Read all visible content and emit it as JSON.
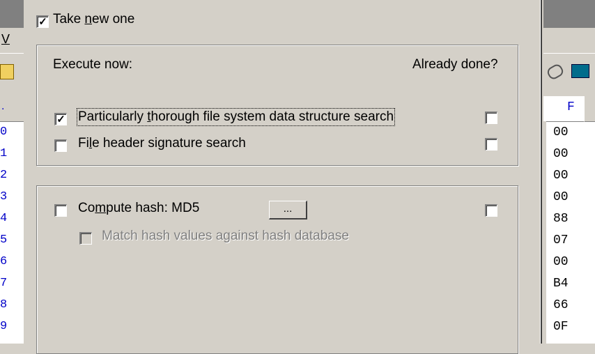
{
  "background": {
    "menu_char": "V",
    "offsets": [
      "0",
      "1",
      "2",
      "3",
      "4",
      "5",
      "6",
      "7",
      "8",
      "9"
    ],
    "hex_header": "F",
    "hex_values": [
      "00",
      "00",
      "00",
      "00",
      "88",
      "07",
      "00",
      "B4",
      "66",
      "0F"
    ]
  },
  "dialog": {
    "take_new_one": {
      "label_pre": "Take ",
      "label_u": "n",
      "label_post": "ew one",
      "checked": true
    },
    "execute_group": {
      "title": "Execute now:",
      "already_done_header": "Already done?",
      "items": [
        {
          "label_pre": "Particularly ",
          "label_u": "t",
          "label_post": "horough file system data structure search",
          "checked": true,
          "done": false
        },
        {
          "label_pre": "Fi",
          "label_u": "l",
          "label_post": "e header signature search",
          "checked": false,
          "done": false
        }
      ]
    },
    "hash_group": {
      "compute_hash": {
        "label_pre": "Co",
        "label_u": "m",
        "label_post": "pute hash: MD5",
        "checked": false,
        "done": false
      },
      "options_button_label": "...",
      "match_hash": {
        "label": "Match hash values against hash database",
        "checked": false,
        "enabled": false
      }
    }
  }
}
